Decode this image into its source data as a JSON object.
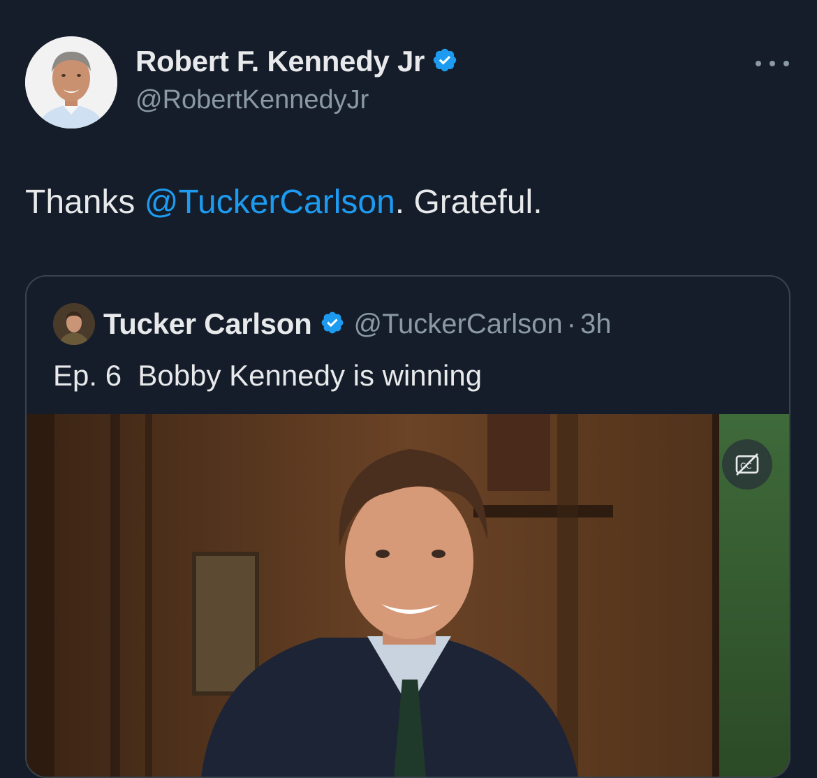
{
  "author": {
    "name": "Robert F. Kennedy Jr",
    "handle": "@RobertKennedyJr",
    "verified": true,
    "avatar_icon": "profile-photo"
  },
  "more_icon": "more-options-icon",
  "tweet": {
    "prefix": "Thanks ",
    "mention": "@TuckerCarlson",
    "suffix": ". Grateful."
  },
  "quoted": {
    "name": "Tucker Carlson",
    "handle": "@TuckerCarlson",
    "separator": "·",
    "time": "3h",
    "verified": true,
    "text": "Ep. 6  Bobby Kennedy is winning",
    "media": {
      "type": "video",
      "captions_icon": "captions-off-icon"
    }
  },
  "colors": {
    "background": "#151d2a",
    "accent": "#1d9bf0",
    "text": "#e7e9ea",
    "muted": "#8b98a5",
    "border": "#38444d"
  }
}
